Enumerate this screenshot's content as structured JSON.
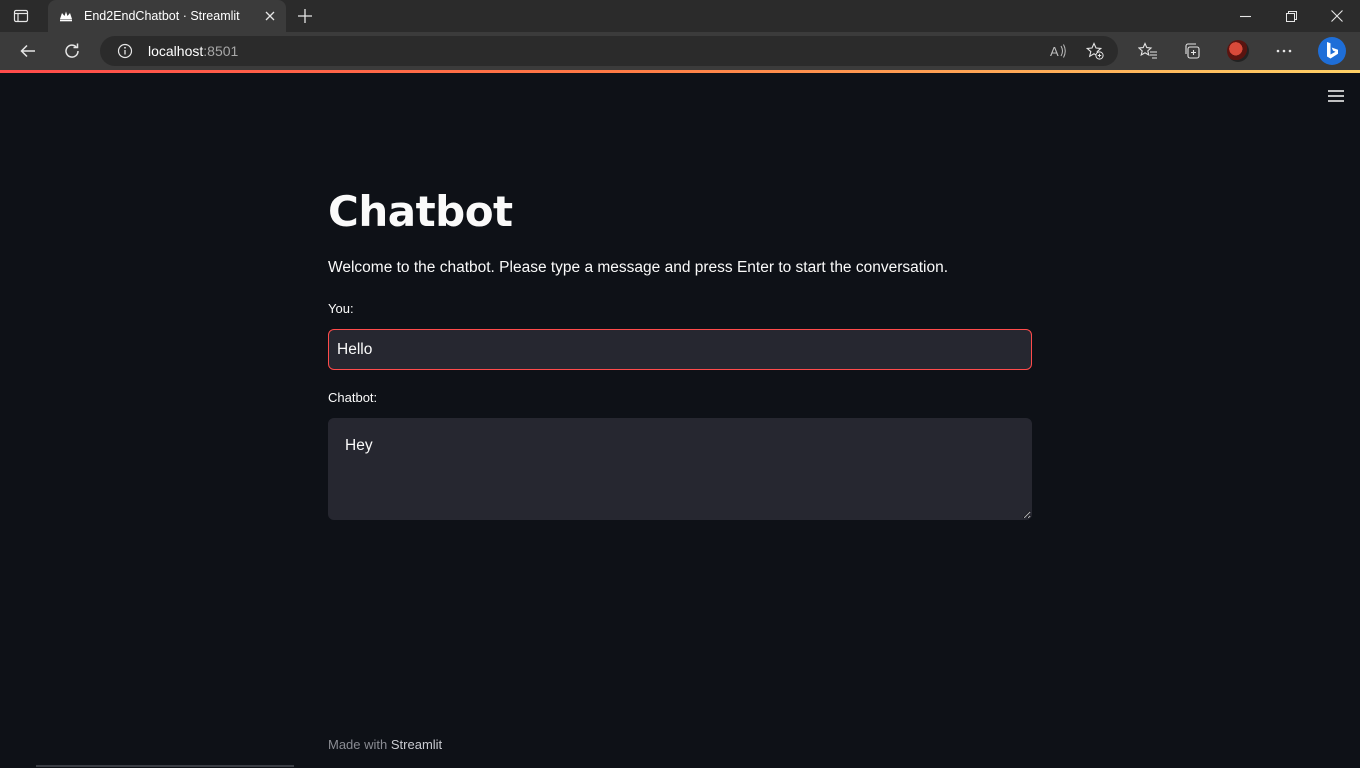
{
  "browser": {
    "tab_title": "End2EndChatbot · Streamlit",
    "url_host": "localhost",
    "url_port": ":8501"
  },
  "app": {
    "title": "Chatbot",
    "welcome": "Welcome to the chatbot. Please type a message and press Enter to start the conversation.",
    "you_label": "You:",
    "you_value": "Hello",
    "bot_label": "Chatbot:",
    "bot_value": "Hey",
    "footer_prefix": "Made with ",
    "footer_brand": "Streamlit"
  },
  "colors": {
    "background": "#0e1117",
    "input_bg": "#262730",
    "accent": "#ff4b4b"
  },
  "icons": [
    "tab-actions-icon",
    "streamlit-favicon-icon",
    "close-tab-icon",
    "new-tab-icon",
    "minimize-icon",
    "restore-icon",
    "close-window-icon",
    "back-icon",
    "refresh-icon",
    "site-info-icon",
    "read-aloud-icon",
    "add-favorite-icon",
    "favorites-icon",
    "collections-icon",
    "profile-avatar",
    "more-icon",
    "bing-icon",
    "hamburger-menu-icon"
  ]
}
